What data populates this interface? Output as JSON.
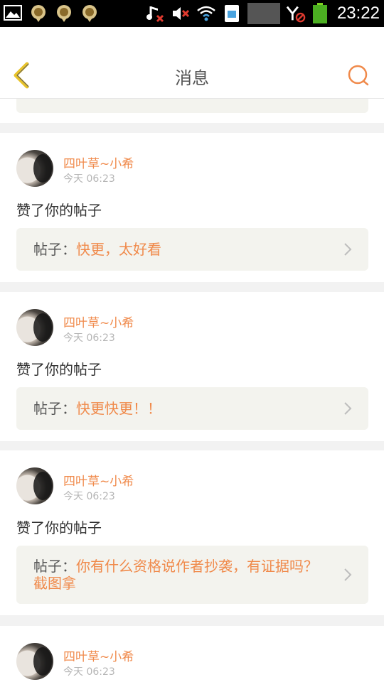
{
  "status_bar": {
    "time": "23:22",
    "left_icons": [
      "gallery-icon",
      "app-notification-icon",
      "app-notification-icon",
      "app-notification-icon"
    ],
    "right_icons": [
      "music-off-icon",
      "mute-icon",
      "wifi-icon",
      "sim-icon",
      "signal-icon",
      "no-data-icon",
      "battery-icon"
    ]
  },
  "header": {
    "title": "消息",
    "back_icon": "chevron-left-icon",
    "search_icon": "search-icon"
  },
  "notifications": [
    {
      "user": "四叶草~小希",
      "time": "今天 06:23",
      "action": "赞了你的帖子",
      "post_prefix": "帖子：",
      "post_title": "快更，太好看"
    },
    {
      "user": "四叶草~小希",
      "time": "今天 06:23",
      "action": "赞了你的帖子",
      "post_prefix": "帖子：",
      "post_title": "快更快更！！"
    },
    {
      "user": "四叶草~小希",
      "time": "今天 06:23",
      "action": "赞了你的帖子",
      "post_prefix": "帖子：",
      "post_title": "你有什么资格说作者抄袭，有证据吗？截图拿"
    },
    {
      "user": "四叶草~小希",
      "time": "今天 06:23"
    }
  ],
  "colors": {
    "accent": "#f08a4b",
    "back_icon": "#e8c32a",
    "card_box": "#f3f3ee",
    "page_bg": "#f2f2f2"
  }
}
